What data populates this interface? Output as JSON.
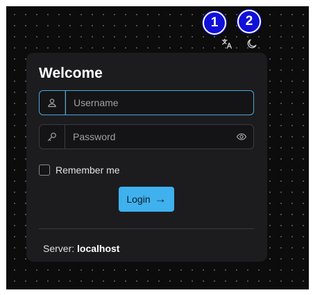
{
  "header": {
    "badges": [
      "1",
      "2"
    ],
    "icons": [
      "translate-icon",
      "moon-icon"
    ]
  },
  "login": {
    "title": "Welcome",
    "username_placeholder": "Username",
    "password_placeholder": "Password",
    "remember_label": "Remember me",
    "remember_checked": false,
    "login_label": "Login",
    "login_arrow": "→",
    "server_label": "Server:",
    "server_value": "localhost"
  },
  "colors": {
    "accent": "#3fb1ee",
    "badge": "#1010d8",
    "background": "#0c0c0c",
    "card": "#1c1c1e"
  }
}
